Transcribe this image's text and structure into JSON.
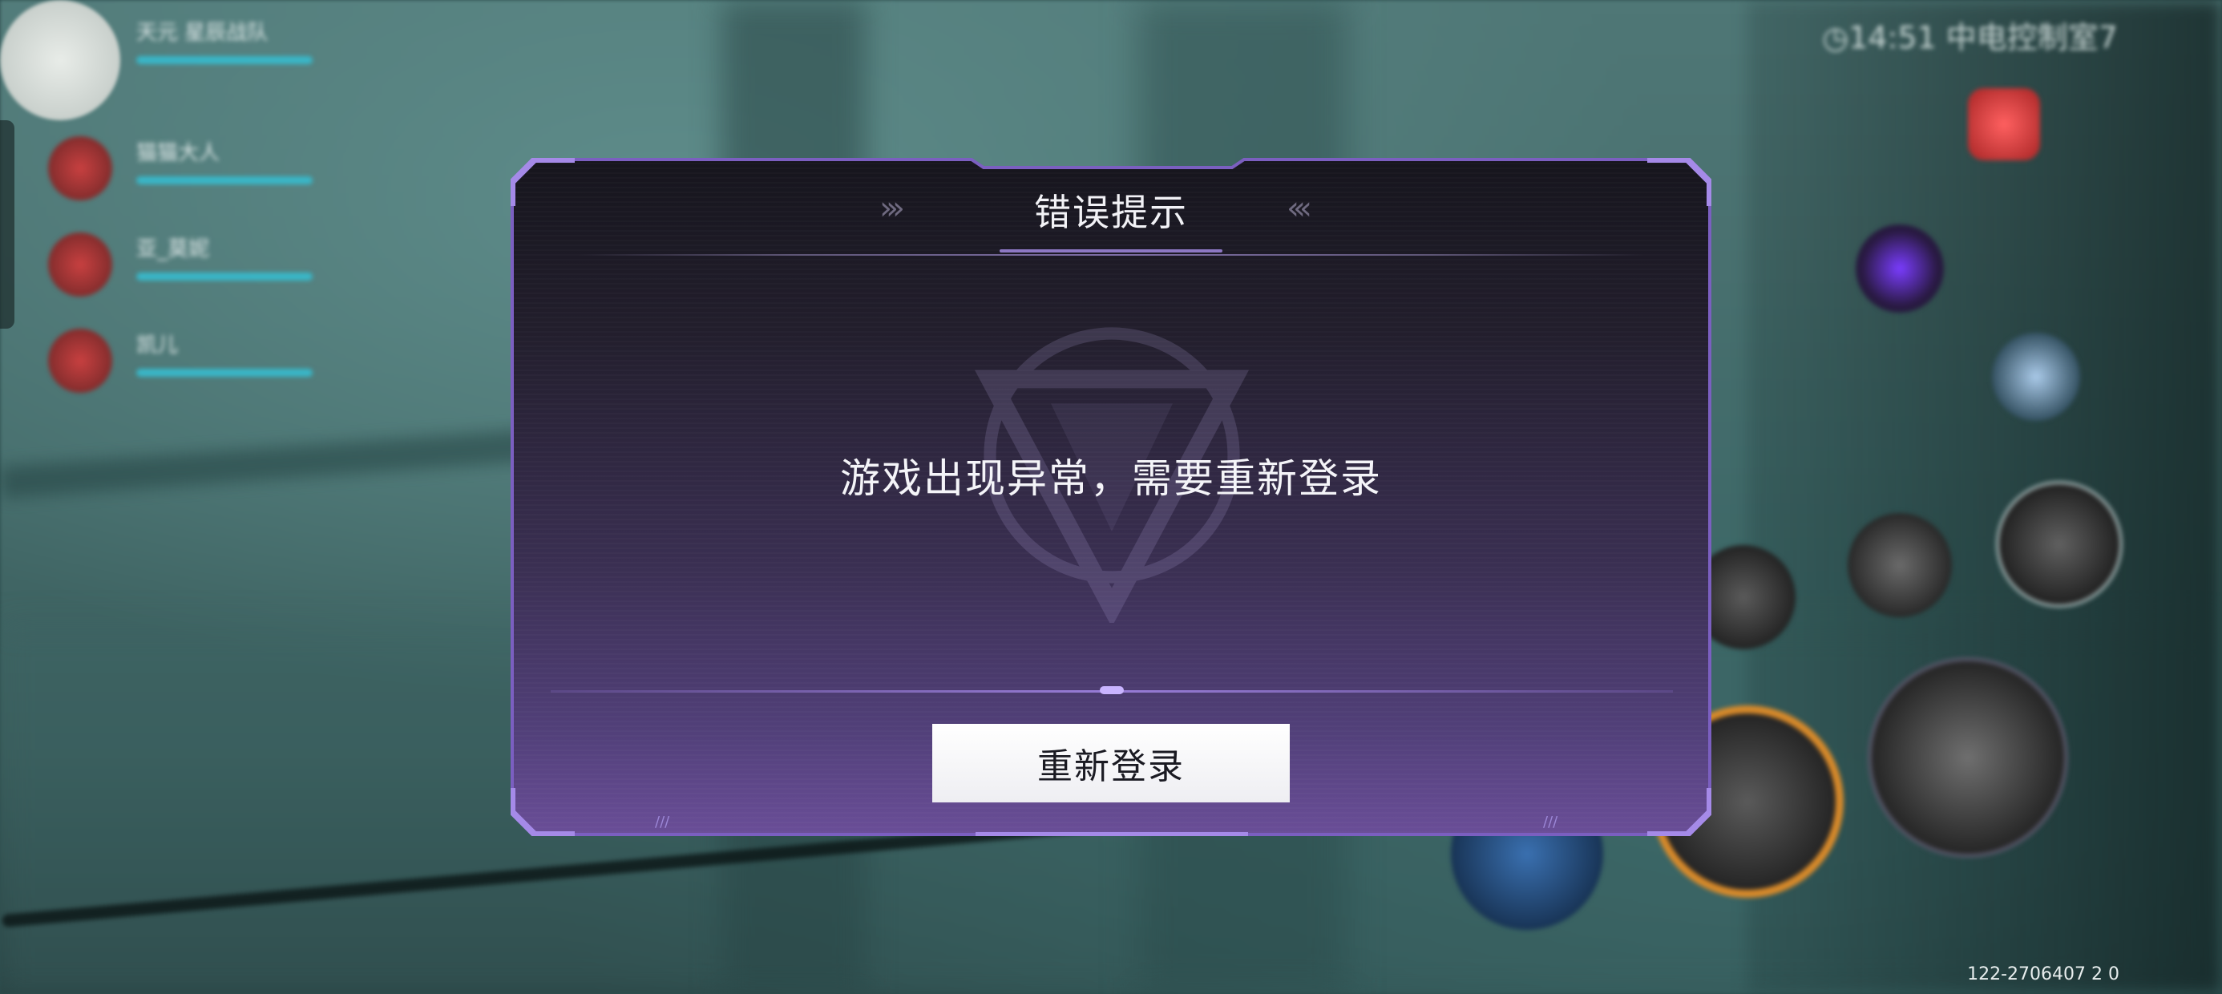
{
  "dialog": {
    "title": "错误提示",
    "title_deco_left": "›››",
    "title_deco_right": "‹‹‹",
    "message": "游戏出现异常，需要重新登录",
    "button_label": "重新登录",
    "corner_deco": "///"
  },
  "hud": {
    "version_text": "122-2706407   2   0",
    "top_right_text": "◷14:51  中电控制室7"
  },
  "team": [
    {
      "name": "天元 星辰战队"
    },
    {
      "name": "猫猫大人"
    },
    {
      "name": "亚_莫妮"
    },
    {
      "name": "凯儿"
    }
  ],
  "colors": {
    "dialog_border": "#7b5fc0",
    "dialog_bottom": "#6a4e98",
    "skill_ring": "#d88a2a",
    "hp_bar": "#39b7c8"
  }
}
